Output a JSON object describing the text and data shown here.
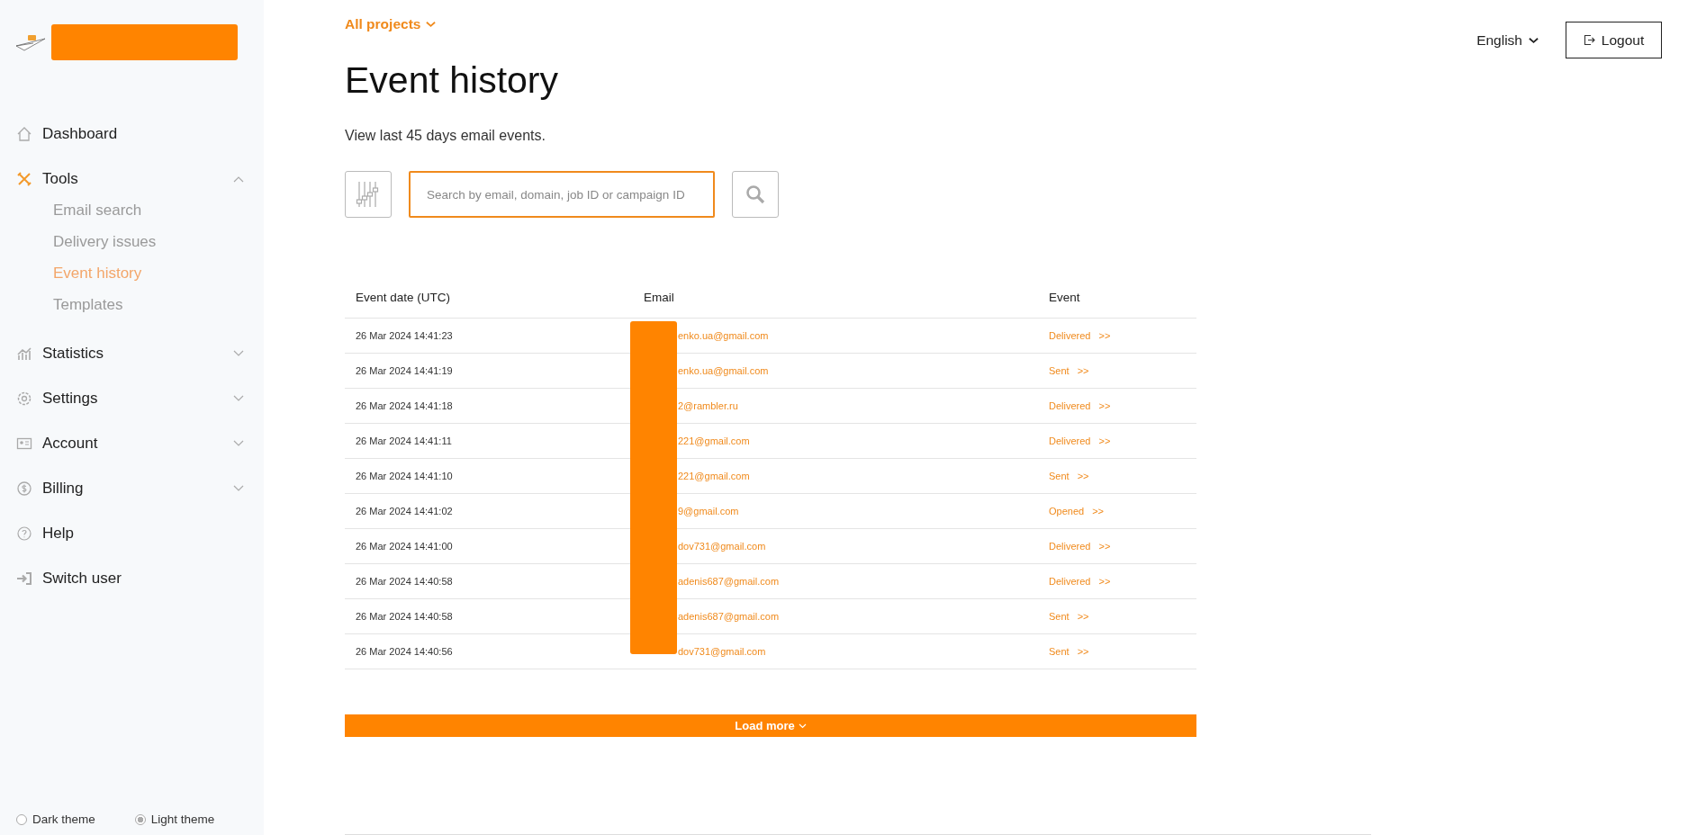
{
  "sidebar": {
    "nav": [
      {
        "label": "Dashboard"
      },
      {
        "label": "Tools",
        "expanded": true,
        "children": [
          {
            "label": "Email search",
            "selected": false
          },
          {
            "label": "Delivery issues",
            "selected": false
          },
          {
            "label": "Event history",
            "selected": true
          },
          {
            "label": "Templates",
            "selected": false
          }
        ]
      },
      {
        "label": "Statistics",
        "expanded": false
      },
      {
        "label": "Settings",
        "expanded": false
      },
      {
        "label": "Account",
        "expanded": false
      },
      {
        "label": "Billing",
        "expanded": false
      },
      {
        "label": "Help"
      },
      {
        "label": "Switch user"
      }
    ],
    "themes": [
      {
        "label": "Dark theme",
        "selected": false
      },
      {
        "label": "Light theme",
        "selected": true
      }
    ]
  },
  "project_switcher": "All projects",
  "language": "English",
  "logout": "Logout",
  "title": "Event history",
  "subtitle": "View last 45 days email events.",
  "search": {
    "placeholder": "Search by email, domain, job ID or campaign ID"
  },
  "table": {
    "columns": [
      "Event date (UTC)",
      "Email",
      "Event"
    ],
    "rows": [
      {
        "date": "26 Mar 2024 14:41:23",
        "email": "enko.ua@gmail.com",
        "event": "Delivered",
        "more": ">>"
      },
      {
        "date": "26 Mar 2024 14:41:19",
        "email": "enko.ua@gmail.com",
        "event": "Sent",
        "more": ">>"
      },
      {
        "date": "26 Mar 2024 14:41:18",
        "email": "2@rambler.ru",
        "event": "Delivered",
        "more": ">>"
      },
      {
        "date": "26 Mar 2024 14:41:11",
        "email": "221@gmail.com",
        "event": "Delivered",
        "more": ">>"
      },
      {
        "date": "26 Mar 2024 14:41:10",
        "email": "221@gmail.com",
        "event": "Sent",
        "more": ">>"
      },
      {
        "date": "26 Mar 2024 14:41:02",
        "email": "9@gmail.com",
        "event": "Opened",
        "more": ">>"
      },
      {
        "date": "26 Mar 2024 14:41:00",
        "email": "dov731@gmail.com",
        "event": "Delivered",
        "more": ">>"
      },
      {
        "date": "26 Mar 2024 14:40:58",
        "email": "adenis687@gmail.com",
        "event": "Delivered",
        "more": ">>"
      },
      {
        "date": "26 Mar 2024 14:40:58",
        "email": "adenis687@gmail.com",
        "event": "Sent",
        "more": ">>"
      },
      {
        "date": "26 Mar 2024 14:40:56",
        "email": "dov731@gmail.com",
        "event": "Sent",
        "more": ">>"
      }
    ]
  },
  "load_more": "Load more"
}
